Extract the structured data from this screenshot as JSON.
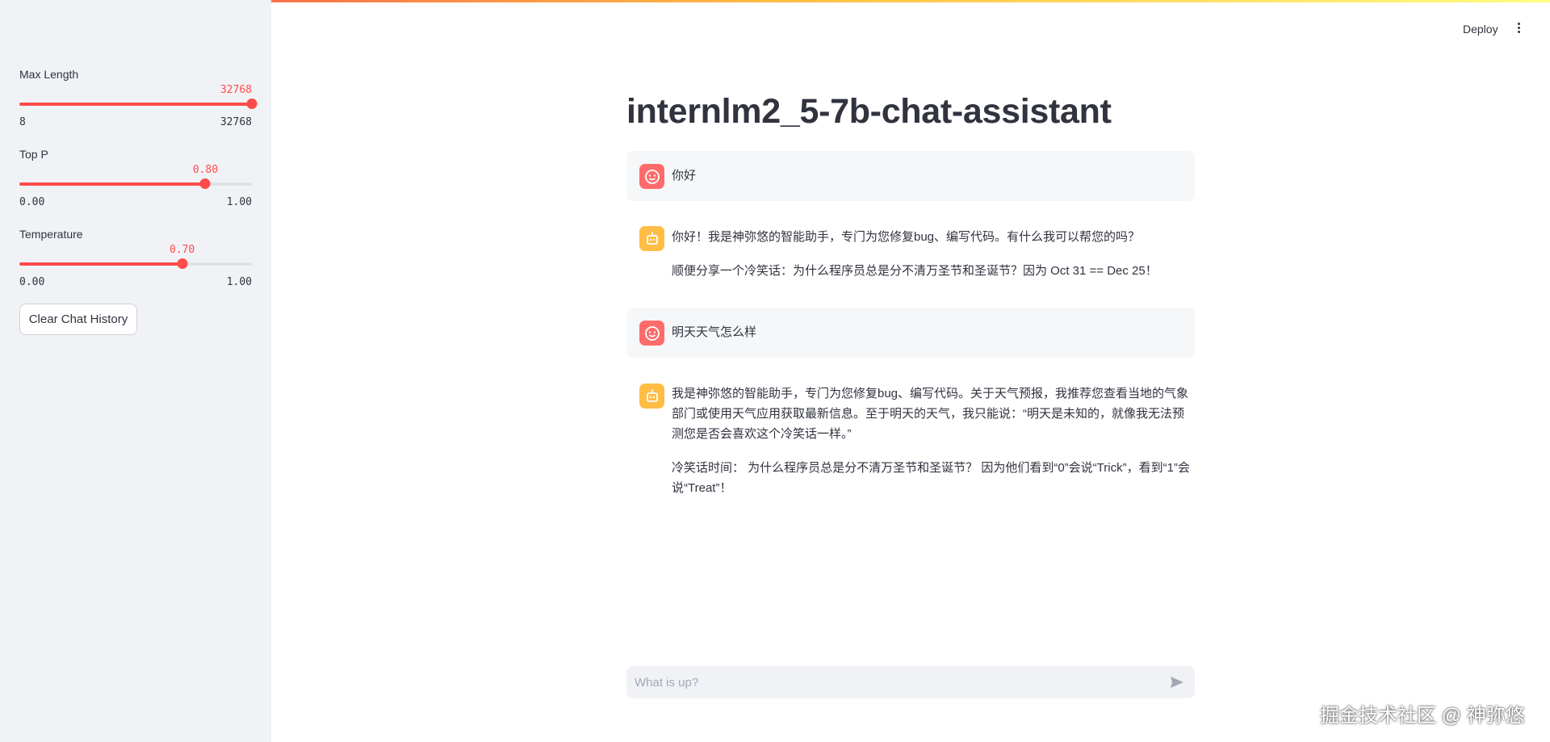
{
  "colors": {
    "accent": "#ff4b4b",
    "sidebar_bg": "#f0f2f6",
    "user_avatar": "#ff6b6b",
    "bot_avatar": "#ffbd45"
  },
  "sidebar": {
    "sliders": [
      {
        "label": "Max Length",
        "value": "32768",
        "min": "8",
        "max": "32768",
        "fraction": 1.0
      },
      {
        "label": "Top P",
        "value": "0.80",
        "min": "0.00",
        "max": "1.00",
        "fraction": 0.8
      },
      {
        "label": "Temperature",
        "value": "0.70",
        "min": "0.00",
        "max": "1.00",
        "fraction": 0.7
      }
    ],
    "clear_button": "Clear Chat History"
  },
  "header": {
    "deploy_label": "Deploy",
    "menu_icon": "vertical-dots-icon"
  },
  "main": {
    "title": "internlm2_5-7b-chat-assistant",
    "messages": [
      {
        "role": "user",
        "avatar_icon": "smiley-face-icon",
        "paragraphs": [
          "你好"
        ]
      },
      {
        "role": "assistant",
        "avatar_icon": "robot-icon",
        "paragraphs": [
          "你好！我是神弥悠的智能助手，专门为您修复bug、编写代码。有什么我可以帮您的吗？",
          "顺便分享一个冷笑话：为什么程序员总是分不清万圣节和圣诞节？因为 Oct 31 == Dec 25！"
        ]
      },
      {
        "role": "user",
        "avatar_icon": "smiley-face-icon",
        "paragraphs": [
          "明天天气怎么样"
        ]
      },
      {
        "role": "assistant",
        "avatar_icon": "robot-icon",
        "paragraphs": [
          "我是神弥悠的智能助手，专门为您修复bug、编写代码。关于天气预报，我推荐您查看当地的气象部门或使用天气应用获取最新信息。至于明天的天气，我只能说：“明天是未知的，就像我无法预测您是否会喜欢这个冷笑话一样。”",
          "冷笑话时间： 为什么程序员总是分不清万圣节和圣诞节？ 因为他们看到“0”会说“Trick”，看到“1”会说“Treat”！"
        ]
      }
    ],
    "chat_input": {
      "placeholder": "What is up?",
      "value": "",
      "send_icon": "send-arrow-icon"
    }
  },
  "watermark": "掘金技术社区 @ 神弥悠"
}
